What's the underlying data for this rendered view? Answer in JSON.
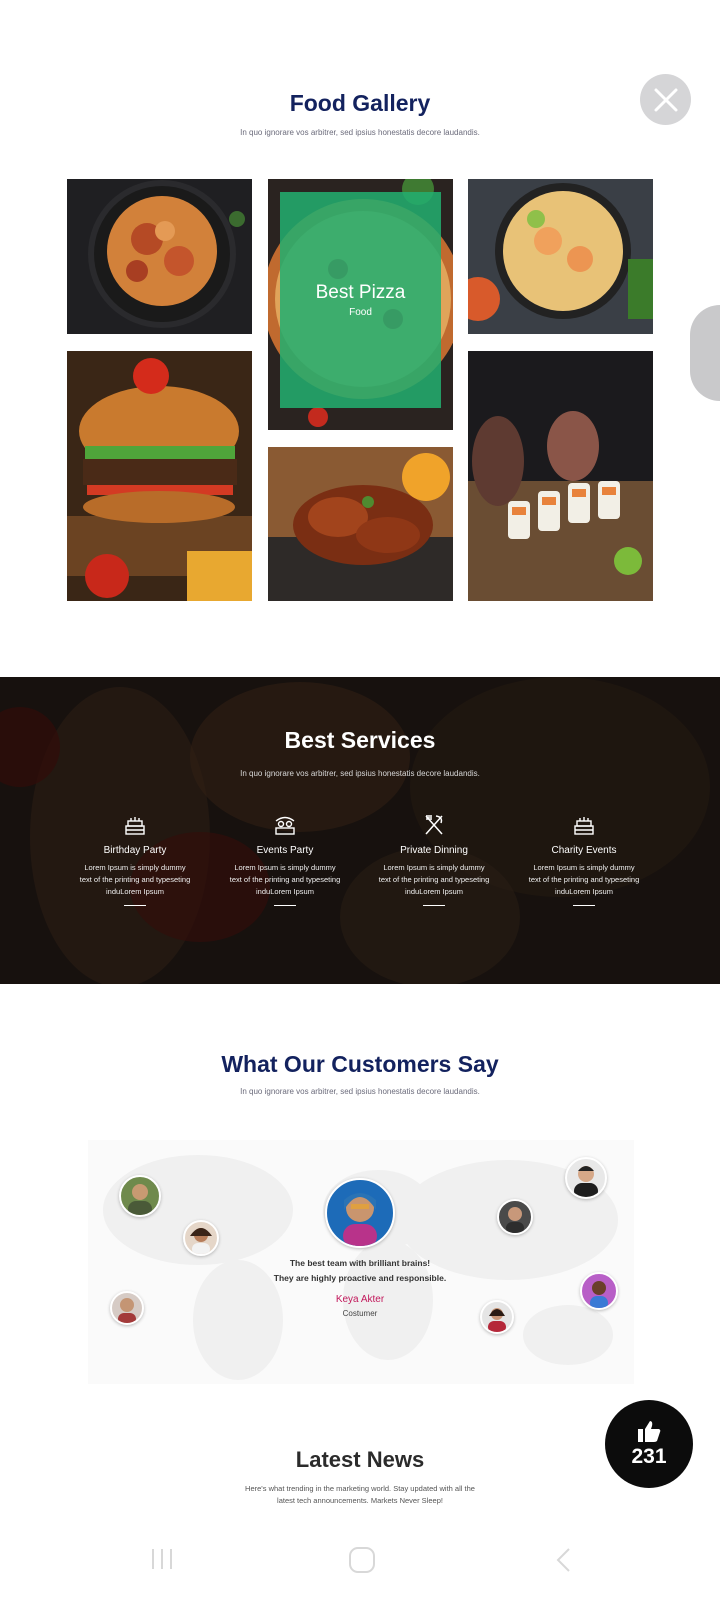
{
  "gallery": {
    "title": "Food Gallery",
    "subtitle": "In quo ignorare vos arbitrer, sed ipsius honestatis decore laudandis.",
    "featured": {
      "title": "Best Pizza",
      "category": "Food"
    },
    "tiles": [
      "shrimp-pasta",
      "pizza",
      "thai-noodles",
      "burger",
      "roasted-chicken",
      "sushi"
    ]
  },
  "services": {
    "title": "Best Services",
    "subtitle": "In quo ignorare vos arbitrer, sed ipsius honestatis decore laudandis.",
    "items": [
      {
        "icon": "cake-icon",
        "title": "Birthday Party",
        "text1": "Lorem Ipsum is simply dummy",
        "text2": "text of the printing and typeseting",
        "text3": "induLorem Ipsum"
      },
      {
        "icon": "couple-icon",
        "title": "Events Party",
        "text1": "Lorem Ipsum is simply dummy",
        "text2": "text of the printing and typeseting",
        "text3": "induLorem Ipsum"
      },
      {
        "icon": "cutlery-icon",
        "title": "Private Dinning",
        "text1": "Lorem Ipsum is simply dummy",
        "text2": "text of the printing and typeseting",
        "text3": "induLorem Ipsum"
      },
      {
        "icon": "cake-icon",
        "title": "Charity Events",
        "text1": "Lorem Ipsum is simply dummy",
        "text2": "text of the printing and typeseting",
        "text3": "induLorem Ipsum"
      }
    ]
  },
  "testimonials": {
    "title": "What Our Customers Say",
    "subtitle": "In quo ignorare vos arbitrer, sed ipsius honestatis decore laudandis.",
    "quote_line1": "The best team with brilliant brains!",
    "quote_line2": "They are highly proactive and responsible.",
    "name": "Keya Akter",
    "role": "Costumer"
  },
  "news": {
    "title": "Latest News",
    "subtitle_line1": "Here's what trending in the marketing world. Stay updated with all the",
    "subtitle_line2": "latest tech announcements. Markets Never Sleep!"
  },
  "like": {
    "count": "231"
  },
  "colors": {
    "heading": "#13225e",
    "accent": "#22af70",
    "name": "#c2185b"
  }
}
